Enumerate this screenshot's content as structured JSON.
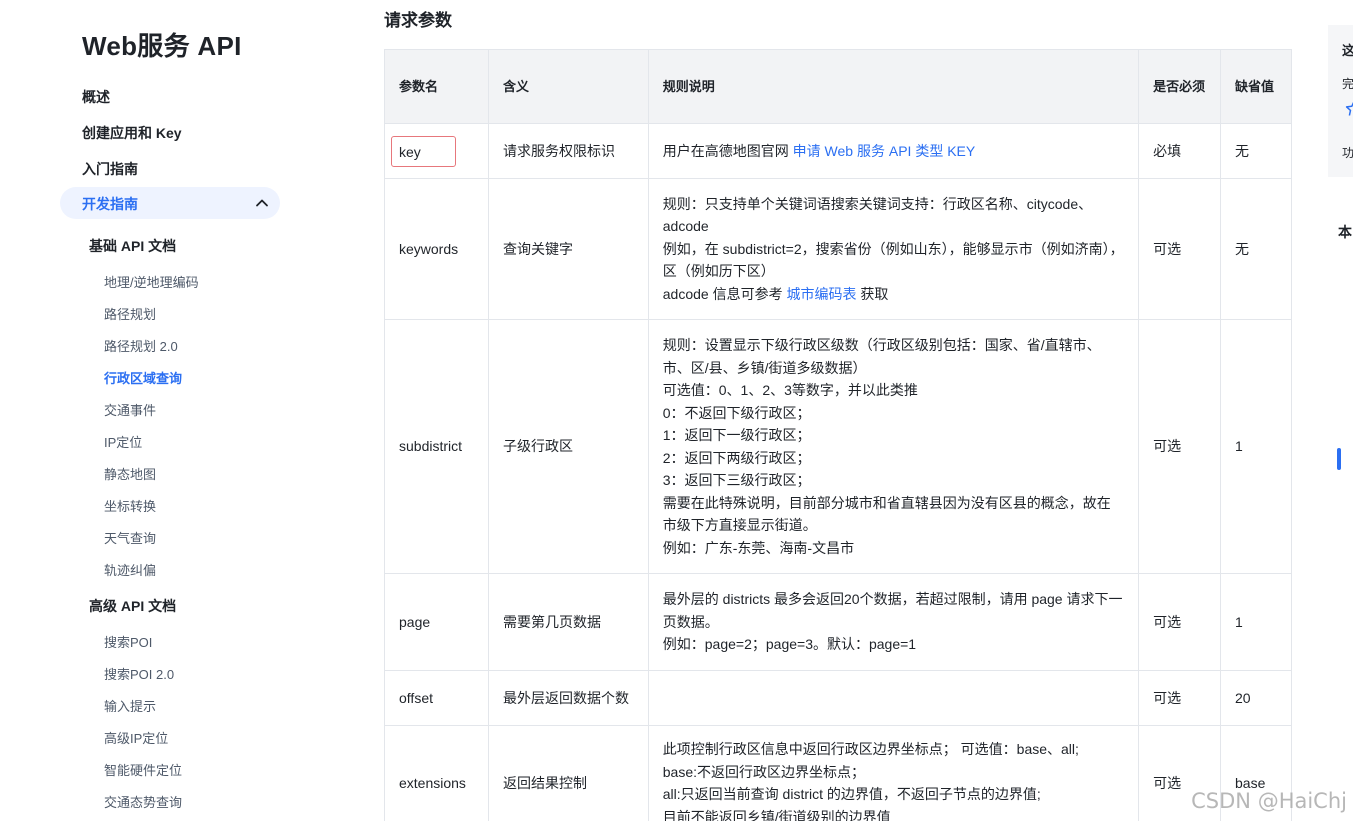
{
  "site_title": "Web服务 API",
  "nav": {
    "top_items": [
      "概述",
      "创建应用和 Key",
      "入门指南"
    ],
    "dev_guide": "开发指南",
    "groups": [
      {
        "label": "基础 API 文档",
        "items": [
          "地理/逆地理编码",
          "路径规划",
          "路径规划 2.0",
          "行政区域查询",
          "交通事件",
          "IP定位",
          "静态地图",
          "坐标转换",
          "天气查询",
          "轨迹纠偏"
        ]
      },
      {
        "label": "高级 API 文档",
        "items": [
          "搜索POI",
          "搜索POI 2.0",
          "输入提示",
          "高级IP定位",
          "智能硬件定位",
          "交通态势查询"
        ]
      }
    ],
    "active_item": "行政区域查询"
  },
  "section_title": "请求参数",
  "table": {
    "headers": [
      "参数名",
      "含义",
      "规则说明",
      "是否必须",
      "缺省值"
    ],
    "rows": [
      {
        "name": "key",
        "meaning": "请求服务权限标识",
        "rule_text": "用户在高德地图官网 ",
        "rule_link": "申请 Web 服务 API 类型 KEY",
        "required": "必填",
        "default": "无"
      },
      {
        "name": "keywords",
        "meaning": "查询关键字",
        "rule_lines": [
          "规则：只支持单个关键词语搜索关键词支持：行政区名称、citycode、adcode",
          "例如，在 subdistrict=2，搜索省份（例如山东），能够显示市（例如济南），区（例如历下区）"
        ],
        "rule_prefix": "adcode 信息可参考 ",
        "rule_link": "城市编码表",
        "rule_suffix": " 获取",
        "required": "可选",
        "default": "无"
      },
      {
        "name": "subdistrict",
        "meaning": "子级行政区",
        "rule_lines": [
          "规则：设置显示下级行政区级数（行政区级别包括：国家、省/直辖市、市、区/县、乡镇/街道多级数据）",
          "可选值：0、1、2、3等数字，并以此类推",
          "0：不返回下级行政区；",
          "1：返回下一级行政区；",
          "2：返回下两级行政区；",
          "3：返回下三级行政区；",
          "需要在此特殊说明，目前部分城市和省直辖县因为没有区县的概念，故在市级下方直接显示街道。",
          "例如：广东-东莞、海南-文昌市"
        ],
        "required": "可选",
        "default": "1"
      },
      {
        "name": "page",
        "meaning": "需要第几页数据",
        "rule_lines": [
          "最外层的 districts 最多会返回20个数据，若超过限制，请用 page 请求下一页数据。",
          "例如：page=2；page=3。默认：page=1"
        ],
        "required": "可选",
        "default": "1"
      },
      {
        "name": "offset",
        "meaning": "最外层返回数据个数",
        "rule_lines": [],
        "required": "可选",
        "default": "20"
      },
      {
        "name": "extensions",
        "meaning": "返回结果控制",
        "rule_lines": [
          "此项控制行政区信息中返回行政区边界坐标点；  可选值：base、all;",
          "base:不返回行政区边界坐标点；",
          "all:只返回当前查询 district 的边界值，不返回子节点的边界值;",
          "目前不能返回乡镇/街道级别的边界值"
        ],
        "required": "可选",
        "default": "base"
      }
    ]
  },
  "right_rail": {
    "title_glyph": "这",
    "line1": "完",
    "line2": "功",
    "star_icon": "star-outline-icon",
    "toc_title": "本"
  },
  "watermark": "CSDN @HaiChj",
  "colors": {
    "accent": "#2b6ff2",
    "header_bg": "#f2f3f5",
    "highlight_border": "#e7777c"
  }
}
